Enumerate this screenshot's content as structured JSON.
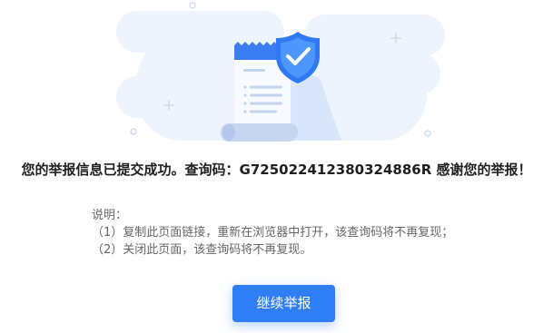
{
  "illustration": {
    "icons": [
      "background-cloud",
      "report-document-icon",
      "shield-check-icon",
      "plus-icon",
      "circle-dot-icon"
    ]
  },
  "message": {
    "prefix": "您的举报信息已提交成功。查询码：",
    "query_code": "G725022412380324886R",
    "suffix": " 感谢您的举报！"
  },
  "notes": {
    "title": "说明：",
    "items": [
      "（1）复制此页面链接，重新在浏览器中打开，该查询码将不再复现；",
      "（2）关闭此页面，该查询码将不再复现。"
    ]
  },
  "actions": {
    "continue_label": "继续举报"
  },
  "colors": {
    "accent": "#2f7ef6",
    "text_primary": "#1f1f1f",
    "text_secondary": "#666666",
    "illustration_bg": "#eef4fd"
  }
}
